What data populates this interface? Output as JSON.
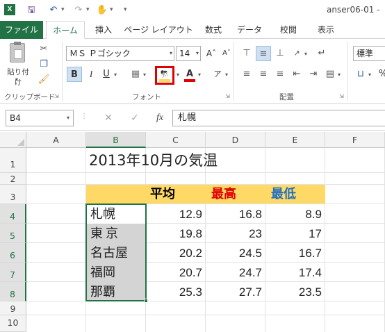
{
  "window": {
    "title": "anser06-01 -"
  },
  "ribbon_tabs": {
    "file": "ファイル",
    "home": "ホーム",
    "insert": "挿入",
    "page_layout": "ページ レイアウト",
    "formulas": "数式",
    "data": "データ",
    "review": "校閲",
    "view": "表示"
  },
  "ribbon": {
    "clipboard_label": "クリップボード",
    "paste_label": "貼り付け",
    "font_label": "フォント",
    "alignment_label": "配置",
    "font_name": "ＭＳ Ｐゴシック",
    "font_size": "14",
    "number_format": "標準",
    "bold": "B",
    "italic": "I",
    "underline": "U",
    "font_color_glyph": "A",
    "fill_color_icon": "paint-bucket-icon",
    "highlight_color": "#e00000",
    "wrap_glyph": "ア"
  },
  "formula_bar": {
    "name_box": "B4",
    "fx": "fx",
    "content": "札幌"
  },
  "columns": [
    "A",
    "B",
    "C",
    "D",
    "E",
    "F"
  ],
  "rows": [
    "1",
    "2",
    "3",
    "4",
    "5",
    "6",
    "7",
    "8",
    "9",
    "10"
  ],
  "sheet": {
    "title": "2013年10月の気温",
    "headers": {
      "avg": "平均",
      "max": "最高",
      "min": "最低"
    },
    "header_colors": {
      "avg": "#000000",
      "max": "#e00000",
      "min": "#1f6fc5"
    },
    "cities": [
      {
        "name": "札幌",
        "avg": "12.9",
        "max": "16.8",
        "min": "8.9"
      },
      {
        "name": "東京",
        "avg": "19.8",
        "max": "23",
        "min": "17"
      },
      {
        "name": "名古屋",
        "avg": "20.2",
        "max": "24.5",
        "min": "16.7"
      },
      {
        "name": "福岡",
        "avg": "20.7",
        "max": "24.7",
        "min": "17.4"
      },
      {
        "name": "那覇",
        "avg": "25.3",
        "max": "27.7",
        "min": "23.5"
      }
    ]
  }
}
